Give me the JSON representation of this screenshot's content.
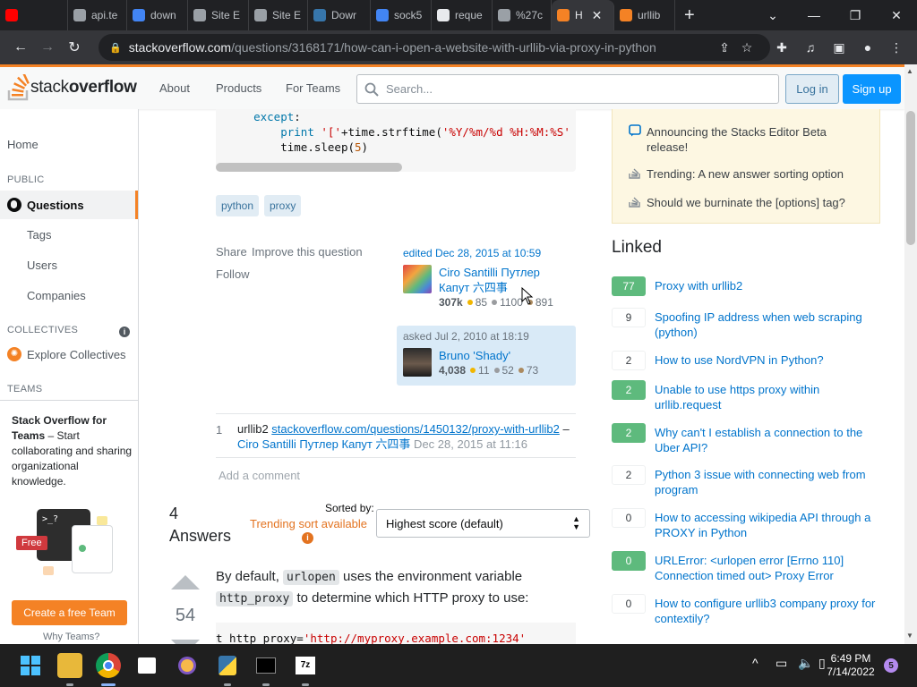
{
  "browser": {
    "tabs": [
      {
        "label": "",
        "icon": "youtube-icon",
        "color": "#ff0000"
      },
      {
        "label": "api.te",
        "icon": "globe-icon",
        "color": "#9aa0a6"
      },
      {
        "label": "down",
        "icon": "google-icon",
        "color": "#4285f4"
      },
      {
        "label": "Site E",
        "icon": "globe-icon",
        "color": "#9aa0a6"
      },
      {
        "label": "Site E",
        "icon": "globe-icon",
        "color": "#9aa0a6"
      },
      {
        "label": "Dowr",
        "icon": "python-icon",
        "color": "#3776ab"
      },
      {
        "label": "sock5",
        "icon": "google-icon",
        "color": "#4285f4"
      },
      {
        "label": "reque",
        "icon": "package-icon",
        "color": "#e8eaed"
      },
      {
        "label": "%27c",
        "icon": "globe-icon",
        "color": "#9aa0a6"
      },
      {
        "label": "H",
        "icon": "stackoverflow-icon",
        "color": "#f48225"
      },
      {
        "label": "urllib",
        "icon": "stackoverflow-icon",
        "color": "#f48225"
      }
    ],
    "url_host": "stackoverflow.com",
    "url_path": "/questions/3168171/how-can-i-open-a-website-with-urllib-via-proxy-in-python"
  },
  "header": {
    "logo_light": "stack",
    "logo_bold": "overflow",
    "nav": [
      "About",
      "Products",
      "For Teams"
    ],
    "search_placeholder": "Search...",
    "login": "Log in",
    "signup": "Sign up"
  },
  "leftnav": {
    "home": "Home",
    "public": "PUBLIC",
    "questions": "Questions",
    "tags": "Tags",
    "users": "Users",
    "companies": "Companies",
    "collectives": "COLLECTIVES",
    "explore_collectives": "Explore Collectives",
    "teams": "TEAMS",
    "teams_title": "Stack Overflow for Teams",
    "teams_desc": " – Start collaborating and sharing organizational knowledge.",
    "free_badge": "Free",
    "create_team": "Create a free Team",
    "why_teams": "Why Teams?"
  },
  "question": {
    "code_lines": [
      {
        "indent": "    ",
        "kw": "except",
        "rest": ":"
      },
      {
        "indent": "        ",
        "kw": "",
        "rest": "print '['+time.strftime('%Y/%m/%d %H:%M:%S'"
      },
      {
        "indent": "        ",
        "kw": "",
        "rest": "time.sleep(5)"
      }
    ],
    "tags": [
      "python",
      "proxy"
    ],
    "menu": [
      "Share",
      "Improve this question",
      "Follow"
    ],
    "edited": {
      "when": "edited Dec 28, 2015 at 10:59",
      "user": "Ciro Santilli Путлер Капут 六四事",
      "rep": "307k",
      "gold": "85",
      "silver": "1100",
      "bronze": "891"
    },
    "asked": {
      "when": "asked Jul 2, 2010 at 18:19",
      "user": "Bruno 'Shady'",
      "rep": "4,038",
      "gold": "11",
      "silver": "52",
      "bronze": "73"
    },
    "comment": {
      "score": "1",
      "text": "urllib2 ",
      "link": "stackoverflow.com/questions/1450132/proxy-with-urllib2",
      "sep": " – ",
      "user": "Ciro Santilli Путлер Капут 六四事",
      "date": " Dec 28, 2015 at 11:16"
    },
    "add_comment": "Add a comment"
  },
  "answers": {
    "count_label": "4",
    "answers_word": "Answers",
    "sorted_by": "Sorted by:",
    "trending": "Trending sort available",
    "sort_value": "Highest score (default)",
    "first": {
      "score": "54",
      "text_1": "By default, ",
      "code_1": "urlopen",
      "text_2": " uses the environment variable",
      "code_2": "http_proxy",
      "text_3": " to determine which HTTP proxy to use:",
      "code_line": "t http_proxy='http://myproxy.example.com:1234'"
    }
  },
  "sidebar": {
    "blog": [
      "Announcing the Stacks Editor Beta release!",
      "Trending: A new answer sorting option",
      "Should we burninate the [options] tag?"
    ],
    "linked_title": "Linked",
    "linked": [
      {
        "score": "77",
        "accepted": true,
        "title": "Proxy with urllib2"
      },
      {
        "score": "9",
        "accepted": false,
        "title": "Spoofing IP address when web scraping (python)"
      },
      {
        "score": "2",
        "accepted": false,
        "title": "How to use NordVPN in Python?"
      },
      {
        "score": "2",
        "accepted": true,
        "title": "Unable to use https proxy within urllib.request"
      },
      {
        "score": "2",
        "accepted": true,
        "title": "Why can't I establish a connection to the Uber API?"
      },
      {
        "score": "2",
        "accepted": false,
        "title": "Python 3 issue with connecting web from program"
      },
      {
        "score": "0",
        "accepted": false,
        "title": "How to accessing wikipedia API through a PROXY in Python"
      },
      {
        "score": "0",
        "accepted": true,
        "title": "URLError: <urlopen error [Errno 110] Connection timed out> Proxy Error"
      },
      {
        "score": "0",
        "accepted": false,
        "title": "How to configure urllib3 company proxy for contextily?"
      }
    ]
  },
  "taskbar": {
    "time": "6:49 PM",
    "date": "7/14/2022",
    "notifications": "5"
  },
  "colors": {
    "so_orange": "#f48225",
    "link_blue": "#0074cc",
    "accepted_green": "#5eba7d"
  }
}
